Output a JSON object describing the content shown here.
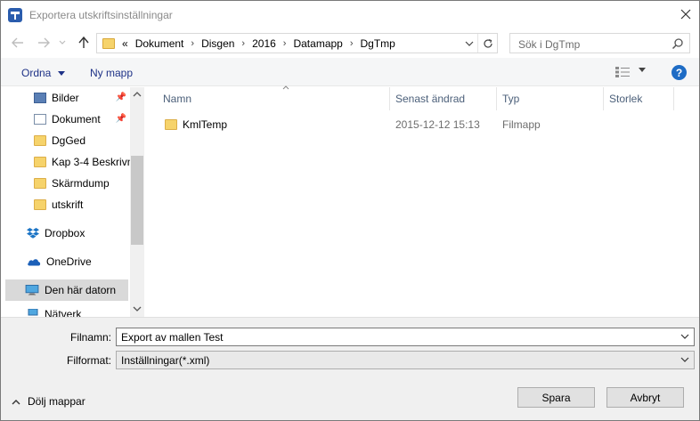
{
  "window": {
    "title": "Exportera utskriftsinställningar"
  },
  "address": {
    "overflow": "«",
    "crumbs": [
      "Dokument",
      "Disgen",
      "2016",
      "Datamapp",
      "DgTmp"
    ],
    "search_placeholder": "Sök i DgTmp"
  },
  "toolbar": {
    "organize": "Ordna",
    "new_folder": "Ny mapp",
    "help": "?"
  },
  "nav": {
    "items": [
      {
        "label": "Bilder",
        "icon": "pictures-icon",
        "pinned": true
      },
      {
        "label": "Dokument",
        "icon": "documents-icon",
        "pinned": true
      },
      {
        "label": "DgGed",
        "icon": "folder-icon"
      },
      {
        "label": "Kap 3-4 Beskrivn",
        "icon": "folder-icon"
      },
      {
        "label": "Skärmdump",
        "icon": "folder-icon"
      },
      {
        "label": "utskrift",
        "icon": "folder-icon"
      },
      {
        "label": "Dropbox",
        "icon": "dropbox-icon"
      },
      {
        "label": "OneDrive",
        "icon": "onedrive-icon"
      },
      {
        "label": "Den här datorn",
        "icon": "computer-icon",
        "selected": true
      },
      {
        "label": "Nätverk",
        "icon": "network-icon"
      }
    ]
  },
  "columns": [
    "Namn",
    "Senast ändrad",
    "Typ",
    "Storlek"
  ],
  "files": [
    {
      "name": "KmlTemp",
      "modified": "2015-12-12 15:13",
      "type": "Filmapp",
      "size": ""
    }
  ],
  "form": {
    "filename_label": "Filnamn:",
    "filename_value": "Export av mallen Test",
    "format_label": "Filformat:",
    "format_value": "Inställningar(*.xml)"
  },
  "footer": {
    "hide_folders": "Dölj mappar",
    "save": "Spara",
    "cancel": "Avbryt"
  },
  "colors": {
    "accent": "#1e6cc5",
    "link": "#1e3287",
    "folder": "#f6d36b"
  }
}
